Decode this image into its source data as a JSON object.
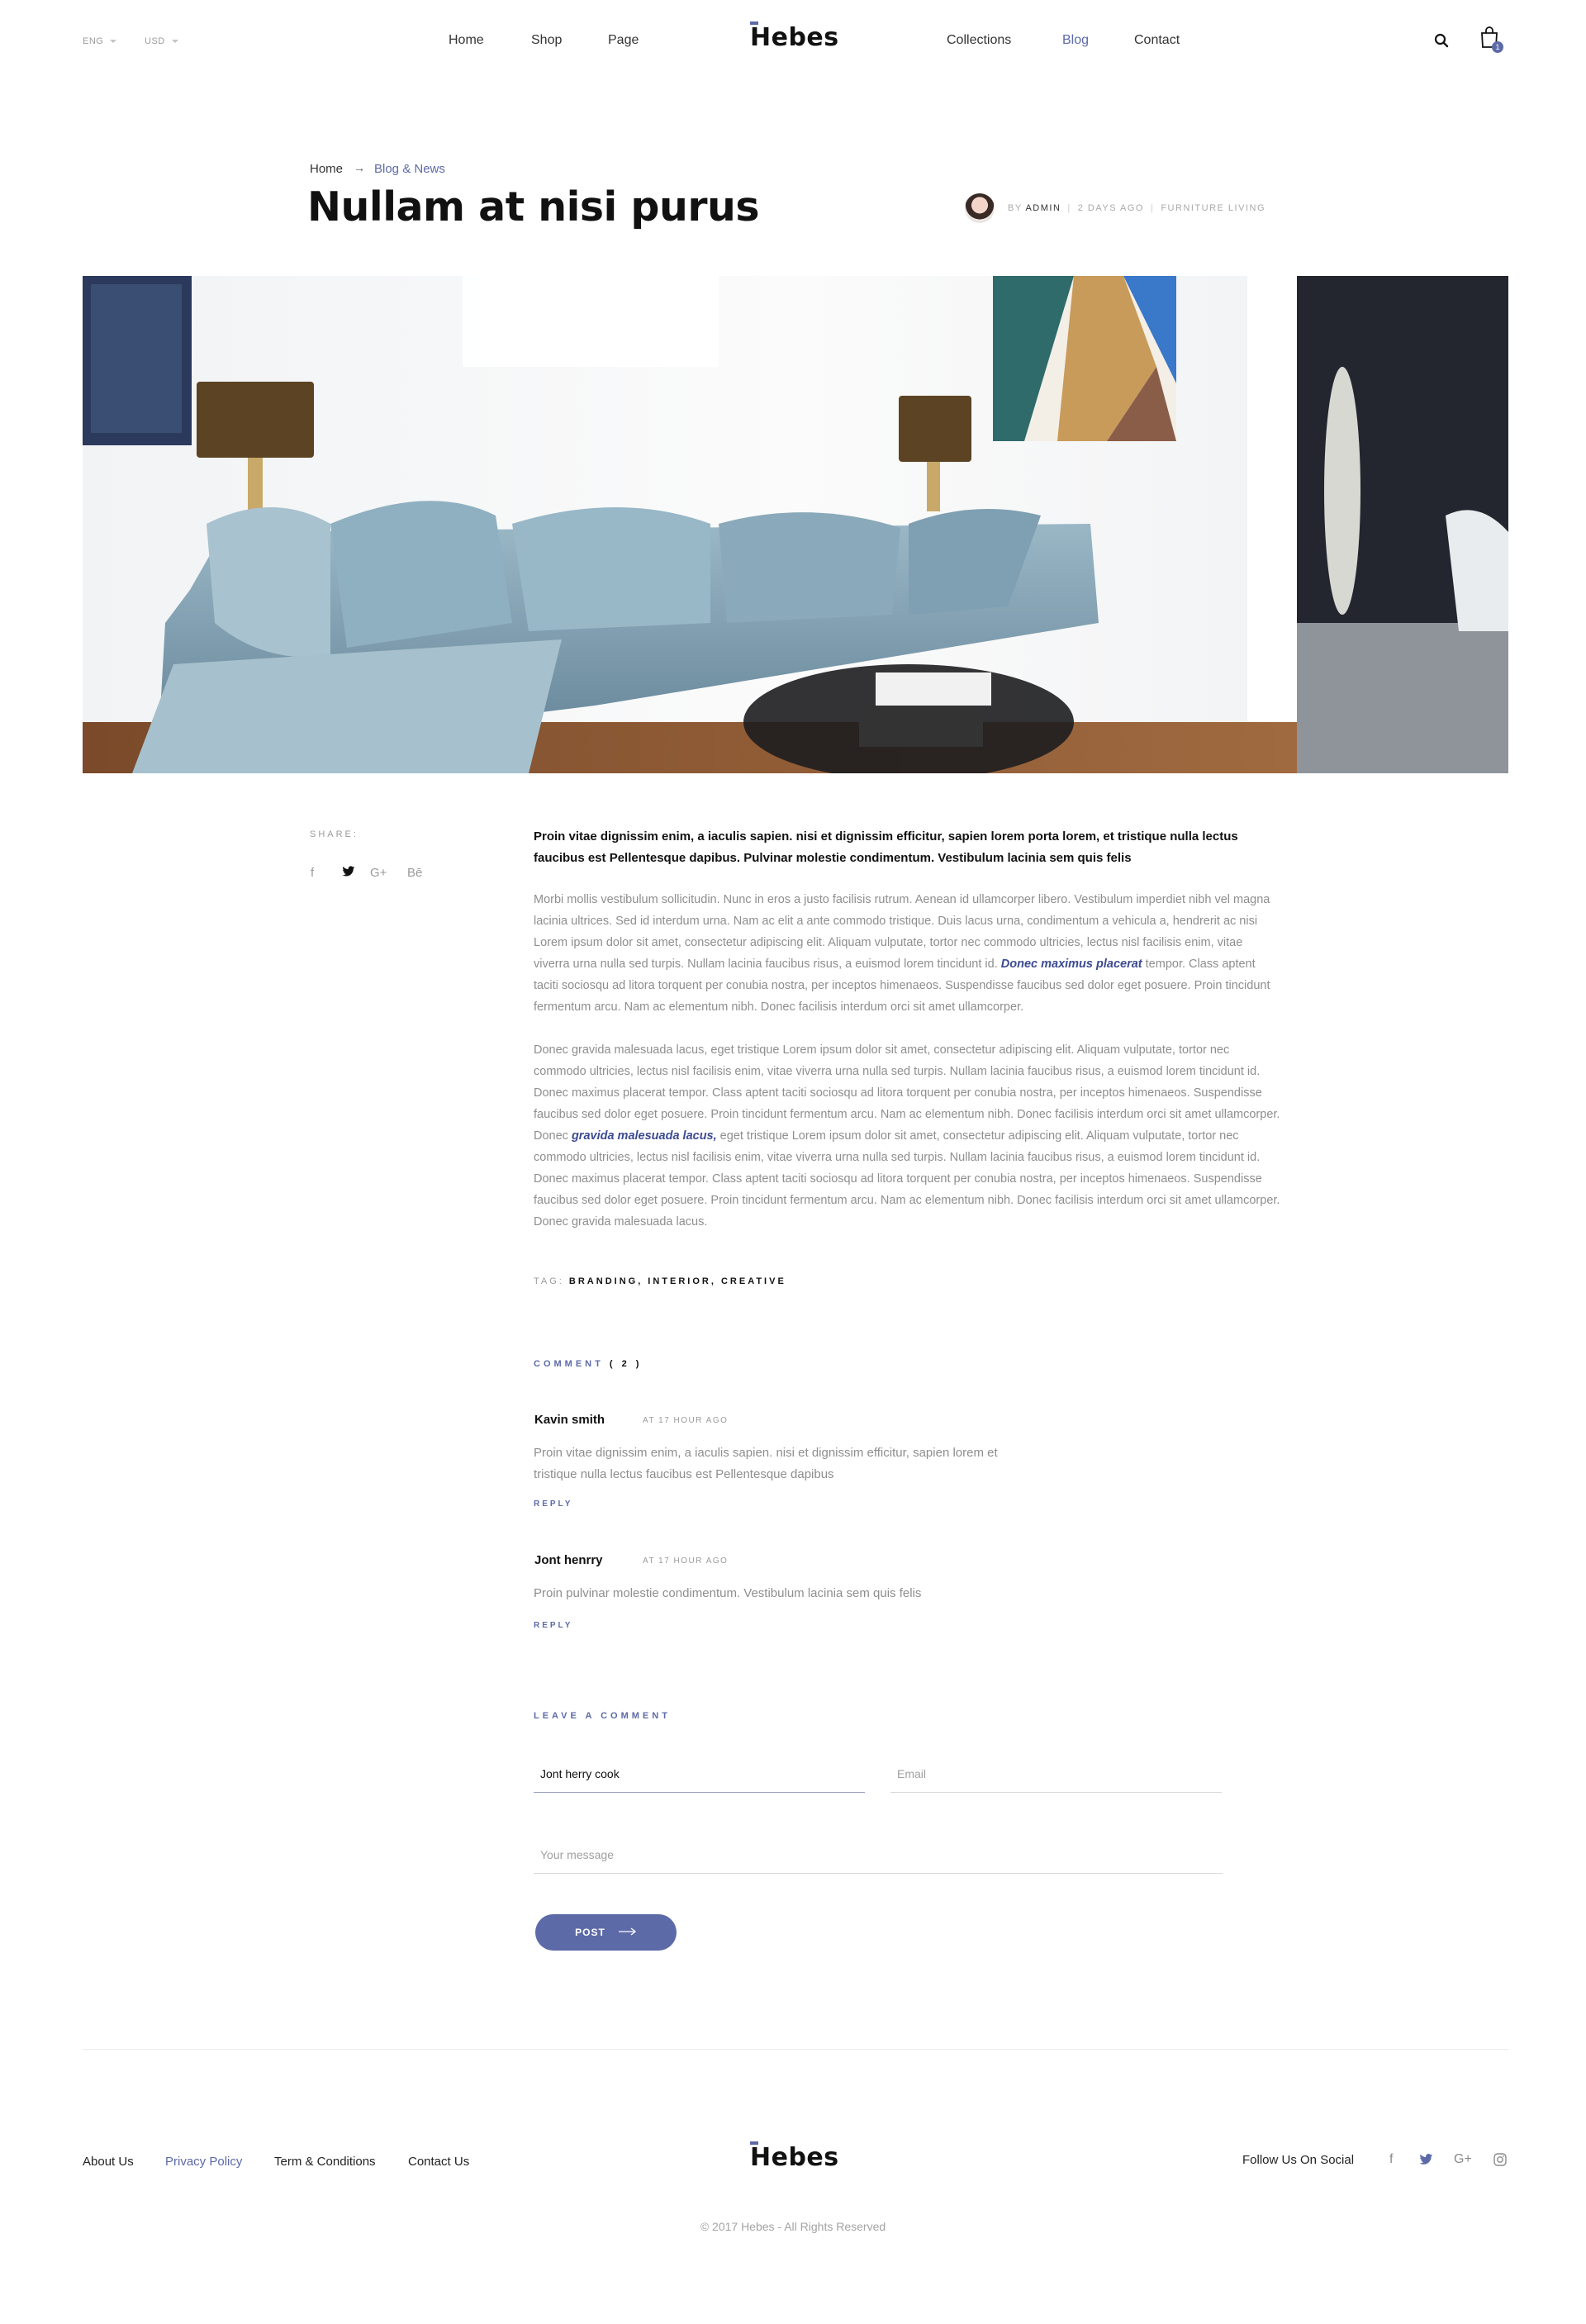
{
  "header": {
    "language": "ENG",
    "currency": "USD",
    "nav_left": [
      "Home",
      "Shop",
      "Page"
    ],
    "logo": "Hebes",
    "nav_right": [
      "Collections",
      "Blog",
      "Contact"
    ],
    "active_nav": "Blog",
    "cart_count": "1"
  },
  "breadcrumb": {
    "home": "Home",
    "current": "Blog & News"
  },
  "post": {
    "title": "Nullam at nisi purus",
    "by_prefix": "BY",
    "author": "ADMIN",
    "time": "2 DAYS AGO",
    "category": "FURNITURE LIVING",
    "lead": "Proin vitae dignissim enim, a iaculis sapien. nisi et dignissim efficitur, sapien lorem porta lorem, et tristique nulla lectus faucibus est Pellentesque dapibus. Pulvinar molestie condimentum. Vestibulum lacinia sem quis felis",
    "para1_a": "Morbi mollis vestibulum sollicitudin. Nunc in eros a justo facilisis rutrum. Aenean id ullamcorper libero. Vestibulum imperdiet nibh vel magna lacinia ultrices. Sed id interdum urna. Nam ac elit a ante commodo tristique. Duis lacus urna, condimentum a vehicula a, hendrerit ac nisi Lorem ipsum dolor sit amet, consectetur adipiscing elit. Aliquam vulputate, tortor nec commodo ultricies, lectus nisl facilisis enim, vitae viverra urna nulla sed turpis. Nullam lacinia faucibus risus, a euismod lorem tincidunt id. ",
    "para1_link": "Donec maximus placerat",
    "para1_b": " tempor. Class aptent taciti sociosqu ad litora torquent per conubia nostra, per inceptos himenaeos. Suspendisse faucibus sed dolor eget posuere. Proin tincidunt fermentum arcu. Nam ac elementum nibh. Donec facilisis interdum orci sit amet ullamcorper.",
    "para2_a": "Donec gravida malesuada lacus, eget tristique Lorem ipsum dolor sit amet, consectetur adipiscing elit. Aliquam vulputate, tortor nec commodo ultricies, lectus nisl facilisis enim, vitae viverra urna nulla sed turpis. Nullam lacinia faucibus risus, a euismod lorem tincidunt id. Donec maximus placerat tempor. Class aptent taciti sociosqu ad litora torquent per conubia nostra, per inceptos himenaeos. Suspendisse faucibus sed dolor eget posuere. Proin tincidunt fermentum arcu. Nam ac elementum nibh. Donec facilisis interdum orci sit amet ullamcorper. Donec ",
    "para2_link": "gravida malesuada lacus,",
    "para2_b": " eget tristique Lorem ipsum dolor sit amet, consectetur adipiscing elit. Aliquam vulputate, tortor nec commodo ultricies, lectus nisl facilisis enim, vitae viverra urna nulla sed turpis. Nullam lacinia faucibus risus, a euismod lorem tincidunt id. Donec maximus placerat tempor. Class aptent taciti sociosqu ad litora torquent per conubia nostra, per inceptos himenaeos. Suspendisse faucibus sed dolor eget posuere. Proin tincidunt fermentum arcu. Nam ac elementum nibh. Donec facilisis interdum orci sit amet ullamcorper. Donec gravida malesuada lacus.",
    "tag_label": "TAG:",
    "tags": "BRANDING, INTERIOR, CREATIVE"
  },
  "share": {
    "label": "SHARE:",
    "icons": [
      "f",
      "twitter",
      "G+",
      "Bē"
    ]
  },
  "comments": {
    "label": "COMMENT",
    "count": "( 2 )",
    "items": [
      {
        "author": "Kavin smith",
        "time": "AT 17 HOUR AGO",
        "text": "Proin vitae dignissim enim, a iaculis sapien. nisi et dignissim efficitur, sapien lorem et tristique nulla lectus faucibus est Pellentesque dapibus",
        "reply": "REPLY"
      },
      {
        "author": "Jont henrry",
        "time": "AT 17 HOUR AGO",
        "text": "Proin pulvinar molestie condimentum. Vestibulum lacinia sem quis felis",
        "reply": "REPLY"
      }
    ]
  },
  "comment_form": {
    "label": "LEAVE A COMMENT",
    "name_value": "Jont herry cook",
    "email_placeholder": "Email",
    "message_placeholder": "Your message",
    "submit": "POST"
  },
  "footer": {
    "links": [
      "About Us",
      "Privacy Policy",
      "Term & Conditions",
      "Contact Us"
    ],
    "active_link": "Privacy Policy",
    "logo": "Hebes",
    "follow": "Follow Us On Social",
    "copyright": "© 2017 Hebes - All Rights Reserved"
  },
  "colors": {
    "accent": "#5d6aa8",
    "link_dark": "#3c4a92",
    "body_text": "#8e8e8e",
    "heading": "#111111"
  }
}
